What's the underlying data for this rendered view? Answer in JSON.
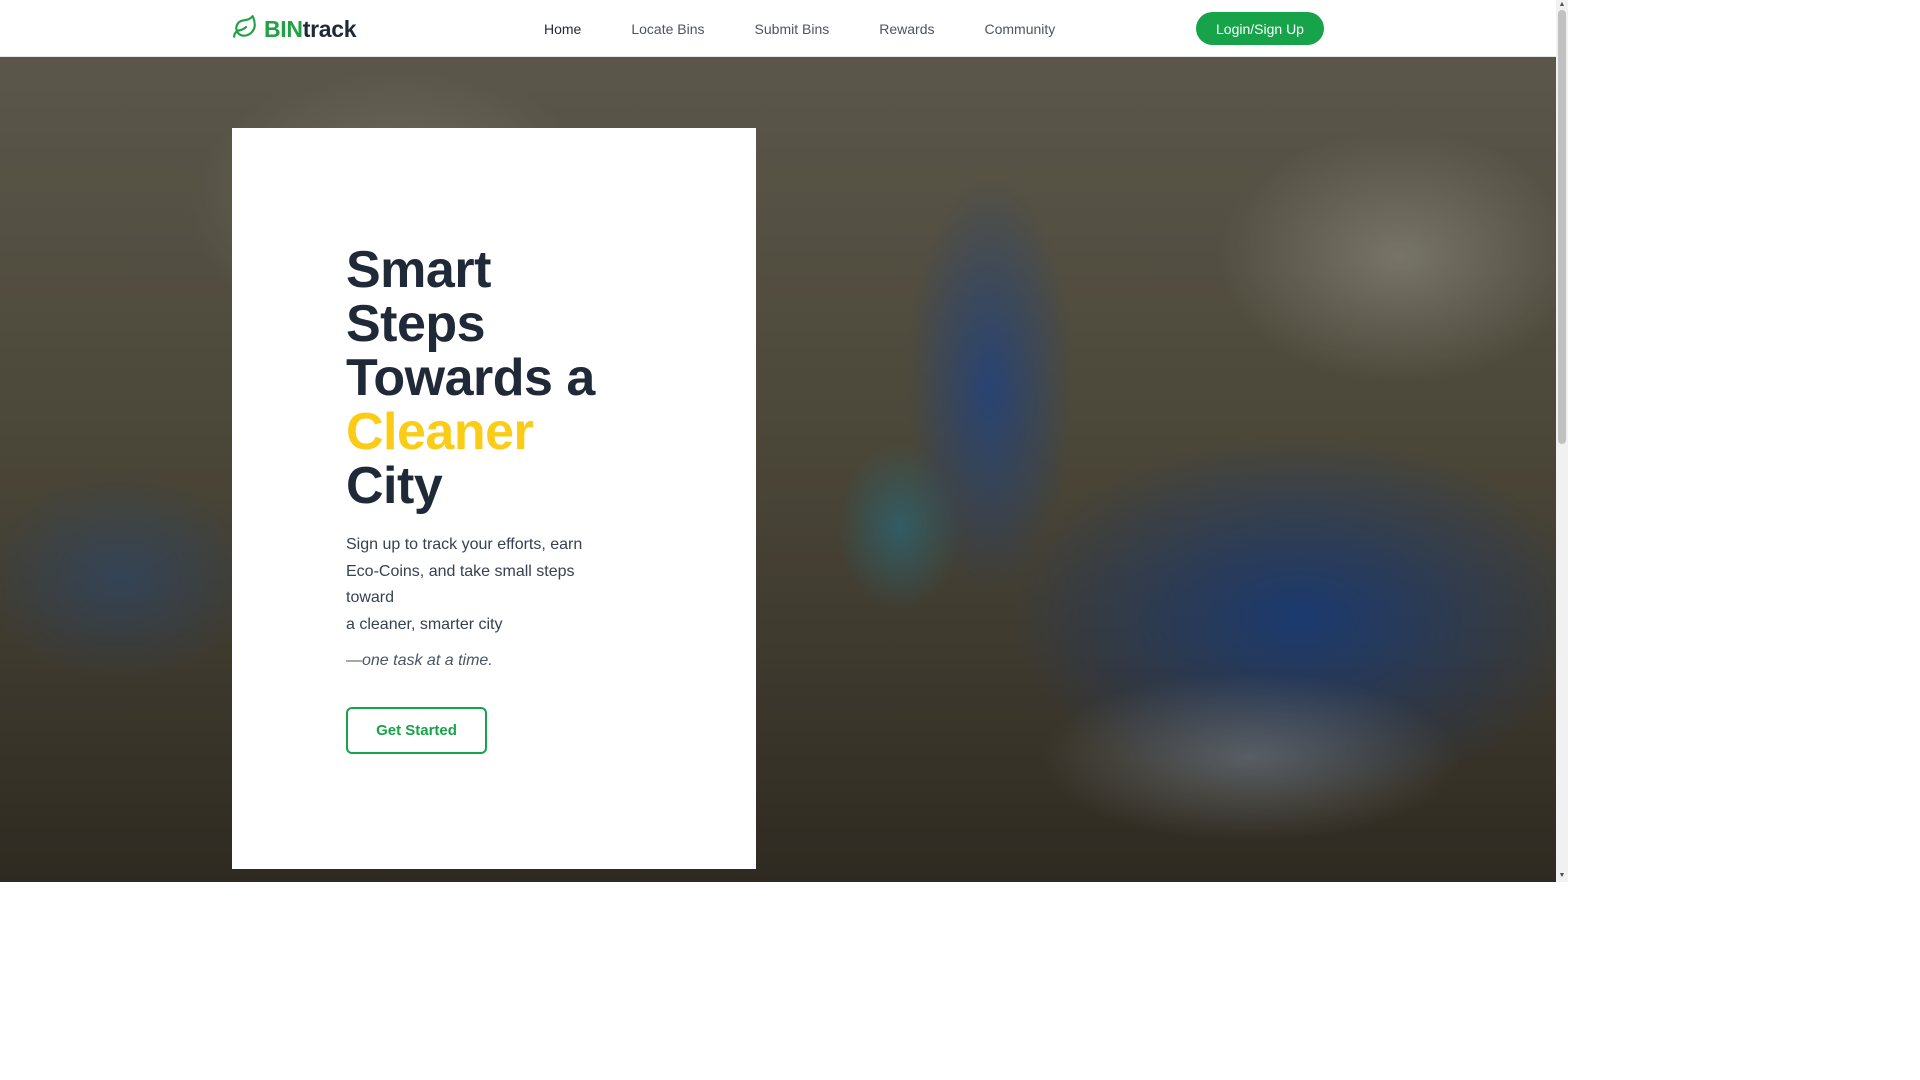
{
  "brand": {
    "logo_icon": "leaf-icon",
    "name_part1": "BIN",
    "name_part2": "track",
    "brand_color": "#22a045"
  },
  "nav": {
    "links": [
      {
        "label": "Home",
        "active": true
      },
      {
        "label": "Locate Bins",
        "active": false
      },
      {
        "label": "Submit Bins",
        "active": false
      },
      {
        "label": "Rewards",
        "active": false
      },
      {
        "label": "Community",
        "active": false
      }
    ],
    "login_label": "Login/Sign Up"
  },
  "hero": {
    "headline_lines": [
      "Smart",
      "Steps",
      "Towards a",
      "Cleaner",
      "City"
    ],
    "accent_color": "#facc15",
    "description_lines": [
      "Sign up to track your efforts, earn",
      "Eco-Coins, and take small steps",
      "toward",
      "a cleaner, smarter city"
    ],
    "tagline": "—one task at a time.",
    "cta_label": "Get Started"
  },
  "colors": {
    "primary_green": "#16a34a",
    "heading_text": "#1f2937"
  }
}
